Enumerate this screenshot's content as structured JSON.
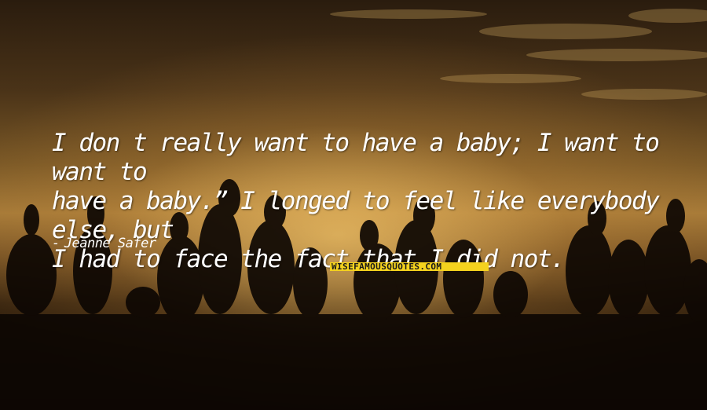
{
  "quote": {
    "text": "I don   t really want to have a baby; I want to want to\nhave a baby.”  I longed to feel like everybody else, but\nI had to face the fact that I did not."
  },
  "author": {
    "dash": "-",
    "name": "Jeanne Safer"
  },
  "watermark": {
    "text": "WISEFAMOUSQUOTES.COM"
  },
  "colors": {
    "text": "#ffffff",
    "watermark_bg": "#f4d21e",
    "sky_glow": "#a67a38"
  }
}
